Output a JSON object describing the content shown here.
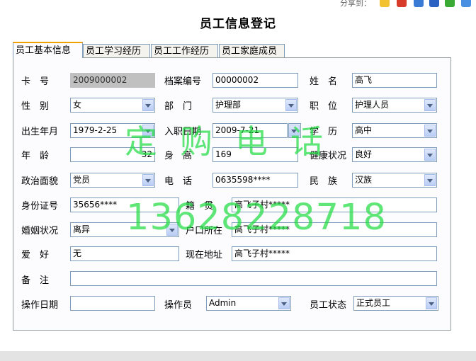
{
  "share": {
    "label": "分享到："
  },
  "page_title": "员工信息登记",
  "tabs": [
    "员工基本信息",
    "员工学习经历",
    "员工工作经历",
    "员工家庭成员"
  ],
  "form": {
    "card_no_label": "卡　号",
    "card_no": "2009000002",
    "file_no_label": "档案编号",
    "file_no": "00000002",
    "name_label": "姓　名",
    "name": "高飞",
    "gender_label": "性　别",
    "gender": "女",
    "dept_label": "部　门",
    "dept": "护理部",
    "position_label": "职　位",
    "position": "护理人员",
    "birth_label": "出生年月",
    "birth": "1979-2-25",
    "hire_label": "入职日期",
    "hire": "2009-7-21",
    "edu_label": "学　历",
    "edu": "高中",
    "age_label": "年　龄",
    "age": "32",
    "height_label": "身　高",
    "height": "169",
    "health_label": "健康状况",
    "health": "良好",
    "politics_label": "政治面貌",
    "politics": "党员",
    "phone_label": "电　话",
    "phone": "0635598****",
    "ethnic_label": "民　族",
    "ethnic": "汉族",
    "idno_label": "身份证号",
    "idno": "35656****",
    "native_label": "籍　贯",
    "native": "高飞子村*****",
    "marital_label": "婚姻状况",
    "marital": "离异",
    "hukou_label": "户口所在",
    "hukou": "高飞子村*****",
    "hobby_label": "爱　好",
    "hobby": "无",
    "address_label": "现在地址",
    "address": "高飞子村*****",
    "remark_label": "备　注",
    "remark": "",
    "opdate_label": "操作日期",
    "opdate": "",
    "operator_label": "操作员",
    "operator": "Admin",
    "status_label": "员工状态",
    "status": "正式员工"
  },
  "watermark": {
    "line1": "定购电话",
    "line2": "13628228718"
  },
  "colors": {
    "watermark": "#22dd44",
    "active_tab_accent": "#f0a000",
    "field_border": "#7f9db9"
  }
}
